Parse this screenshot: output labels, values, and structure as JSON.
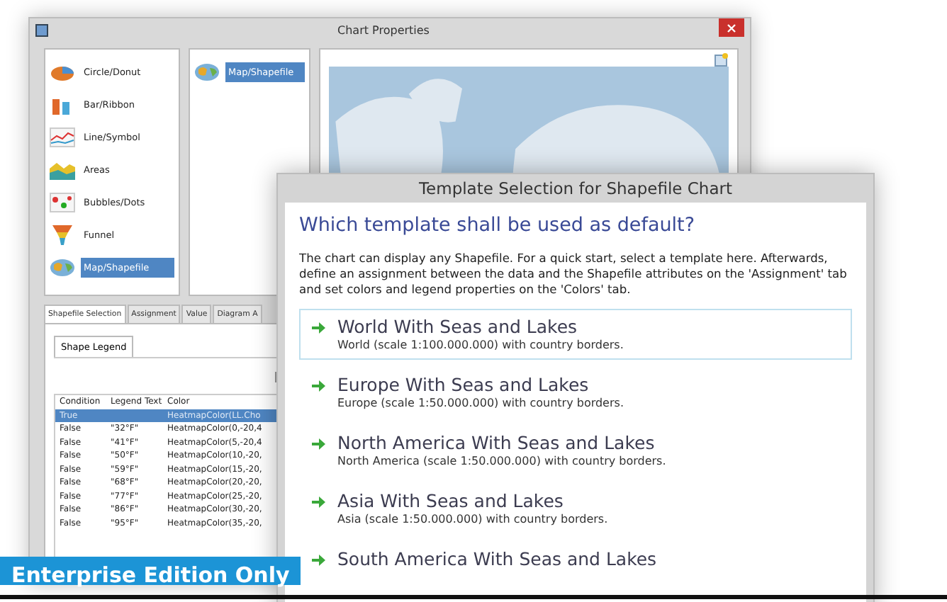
{
  "chart_properties": {
    "title": "Chart Properties",
    "chart_types": [
      {
        "kind": "pie",
        "label": "Circle/Donut",
        "selected": false
      },
      {
        "kind": "bar",
        "label": "Bar/Ribbon",
        "selected": false
      },
      {
        "kind": "line",
        "label": "Line/Symbol",
        "selected": false
      },
      {
        "kind": "area",
        "label": "Areas",
        "selected": false
      },
      {
        "kind": "bubble",
        "label": "Bubbles/Dots",
        "selected": false
      },
      {
        "kind": "funnel",
        "label": "Funnel",
        "selected": false
      },
      {
        "kind": "map",
        "label": "Map/Shapefile",
        "selected": true
      }
    ],
    "subtypes": [
      {
        "label": "Map/Shapefile",
        "selected": true
      }
    ],
    "tabs": [
      {
        "label": "Shapefile Selection",
        "selected": true
      },
      {
        "label": "Assignment",
        "selected": false
      },
      {
        "label": "Value",
        "selected": false
      },
      {
        "label": "Diagram A",
        "selected": false
      }
    ],
    "legend_tab": "Shape Legend",
    "legend_table": {
      "columns": [
        "Condition",
        "Legend Text",
        "Color"
      ],
      "rows": [
        {
          "cells": [
            "True",
            "",
            "HeatmapColor(LL.Cho"
          ],
          "selected": true
        },
        {
          "cells": [
            "False",
            "\"32°F\"",
            "HeatmapColor(0,-20,4"
          ],
          "selected": false
        },
        {
          "cells": [
            "False",
            "\"41°F\"",
            "HeatmapColor(5,-20,4"
          ],
          "selected": false
        },
        {
          "cells": [
            "False",
            "\"50°F\"",
            "HeatmapColor(10,-20,"
          ],
          "selected": false
        },
        {
          "cells": [
            "False",
            "\"59°F\"",
            "HeatmapColor(15,-20,"
          ],
          "selected": false
        },
        {
          "cells": [
            "False",
            "\"68°F\"",
            "HeatmapColor(20,-20,"
          ],
          "selected": false
        },
        {
          "cells": [
            "False",
            "\"77°F\"",
            "HeatmapColor(25,-20,"
          ],
          "selected": false
        },
        {
          "cells": [
            "False",
            "\"86°F\"",
            "HeatmapColor(30,-20,"
          ],
          "selected": false
        },
        {
          "cells": [
            "False",
            "\"95°F\"",
            "HeatmapColor(35,-20,"
          ],
          "selected": false
        }
      ]
    }
  },
  "template_dialog": {
    "title": "Template Selection for Shapefile Chart",
    "heading": "Which template shall be used as default?",
    "description": "The chart can display any Shapefile. For a quick start, select a template here. Afterwards, define an assignment between the data and the Shapefile attributes on the 'Assignment' tab and set colors and legend properties on the 'Colors' tab.",
    "templates": [
      {
        "name": "World With Seas and Lakes",
        "description": "World (scale 1:100.000.000) with country borders.",
        "selected": true
      },
      {
        "name": "Europe With Seas and Lakes",
        "description": "Europe (scale 1:50.000.000) with country borders.",
        "selected": false
      },
      {
        "name": "North America With Seas and Lakes",
        "description": "North America (scale 1:50.000.000) with country borders.",
        "selected": false
      },
      {
        "name": "Asia With Seas and Lakes",
        "description": "Asia (scale 1:50.000.000) with country borders.",
        "selected": false
      },
      {
        "name": "South America With Seas and Lakes",
        "selected": false
      }
    ]
  },
  "banner": "Enterprise Edition Only"
}
